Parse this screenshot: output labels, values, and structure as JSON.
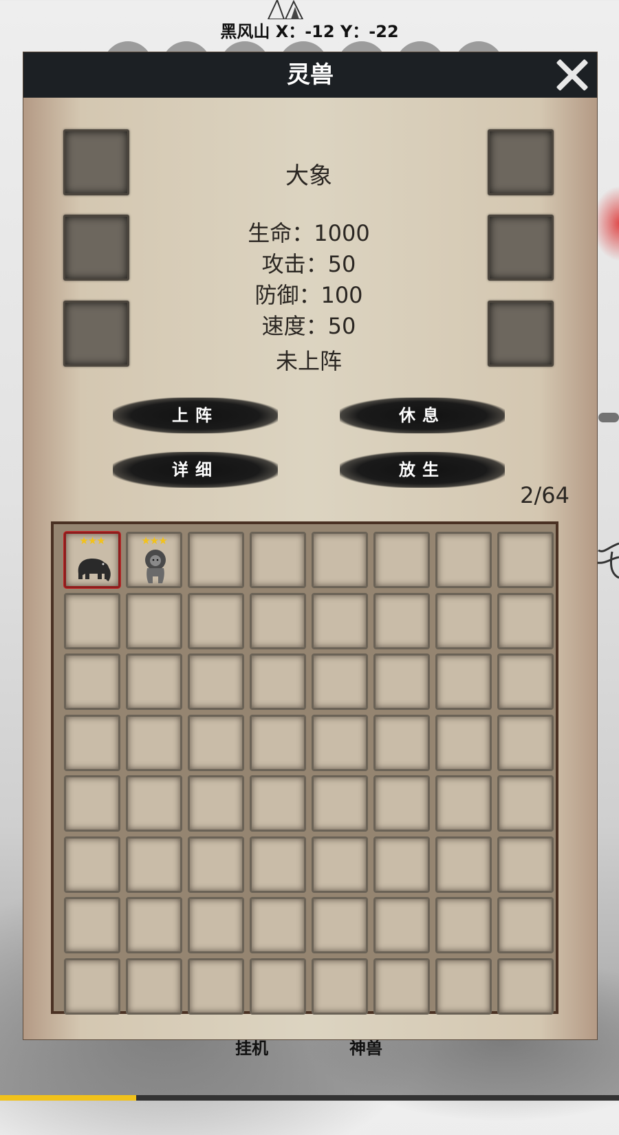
{
  "location": "黑风山 X：-12 Y：-22",
  "panel": {
    "title": "灵兽",
    "close_icon": "close-icon"
  },
  "beast": {
    "name": "大象",
    "hp": "生命：1000",
    "attack": "攻击：50",
    "defense": "防御：100",
    "speed": "速度：50",
    "status": "未上阵"
  },
  "buttons": {
    "deploy": "上阵",
    "rest": "休息",
    "detail": "详细",
    "release": "放生"
  },
  "inventory": {
    "count": "2/64",
    "capacity": 64,
    "items": [
      {
        "name": "elephant",
        "stars": "★★★",
        "selected": true
      },
      {
        "name": "lion",
        "stars": "★★★",
        "selected": false
      }
    ]
  },
  "bottom_nav": {
    "idle": "挂机",
    "divine_beast": "神兽"
  },
  "progress": 0.22,
  "colors": {
    "header": "#1c2024",
    "star": "#f2c21a",
    "selected_border": "#8f1c1c",
    "progress": "#f1c21b"
  }
}
